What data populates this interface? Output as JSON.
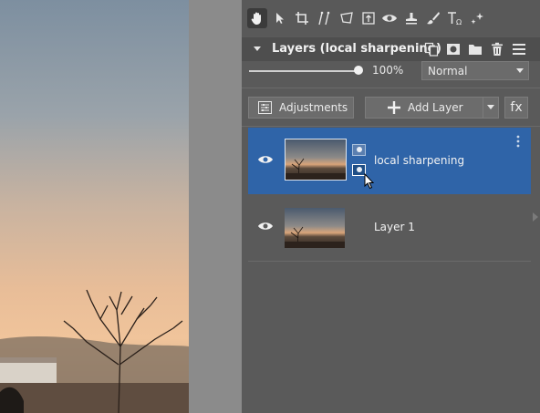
{
  "canvas": {
    "image_name": "landscape-photo"
  },
  "toolbar": {
    "tools": [
      {
        "name": "hand-tool",
        "icon": "hand-icon",
        "active": true
      },
      {
        "name": "select-tool",
        "icon": "arrow-pointer-icon"
      },
      {
        "name": "crop-tool",
        "icon": "crop-icon"
      },
      {
        "name": "straighten-tool",
        "icon": "straighten-icon"
      },
      {
        "name": "transform-tool",
        "icon": "transform-icon"
      },
      {
        "name": "export-tool",
        "icon": "frame-icon"
      },
      {
        "name": "view-tool",
        "icon": "eye-icon"
      },
      {
        "name": "clone-tool",
        "icon": "stamp-icon"
      },
      {
        "name": "brush-tool",
        "icon": "brush-icon"
      },
      {
        "name": "text-tool",
        "icon": "text-icon"
      },
      {
        "name": "effects-tool",
        "icon": "sparkle-icon"
      }
    ]
  },
  "layers_panel": {
    "title": "Layers (local sharpening)",
    "opacity": "100%",
    "opacity_value": 1.0,
    "blend_mode": "Normal",
    "adjustments_label": "Adjustments",
    "add_layer_label": "Add Layer",
    "fx_label": "fx",
    "layers": [
      {
        "name": "local sharpening",
        "selected": true,
        "visible": true,
        "has_mask": true
      },
      {
        "name": "Layer 1",
        "selected": false,
        "visible": true,
        "has_mask": false
      }
    ]
  },
  "colors": {
    "selection": "#2f64a8",
    "panel_bg": "#5a5a5a",
    "header_bg": "#4e4e4e"
  }
}
